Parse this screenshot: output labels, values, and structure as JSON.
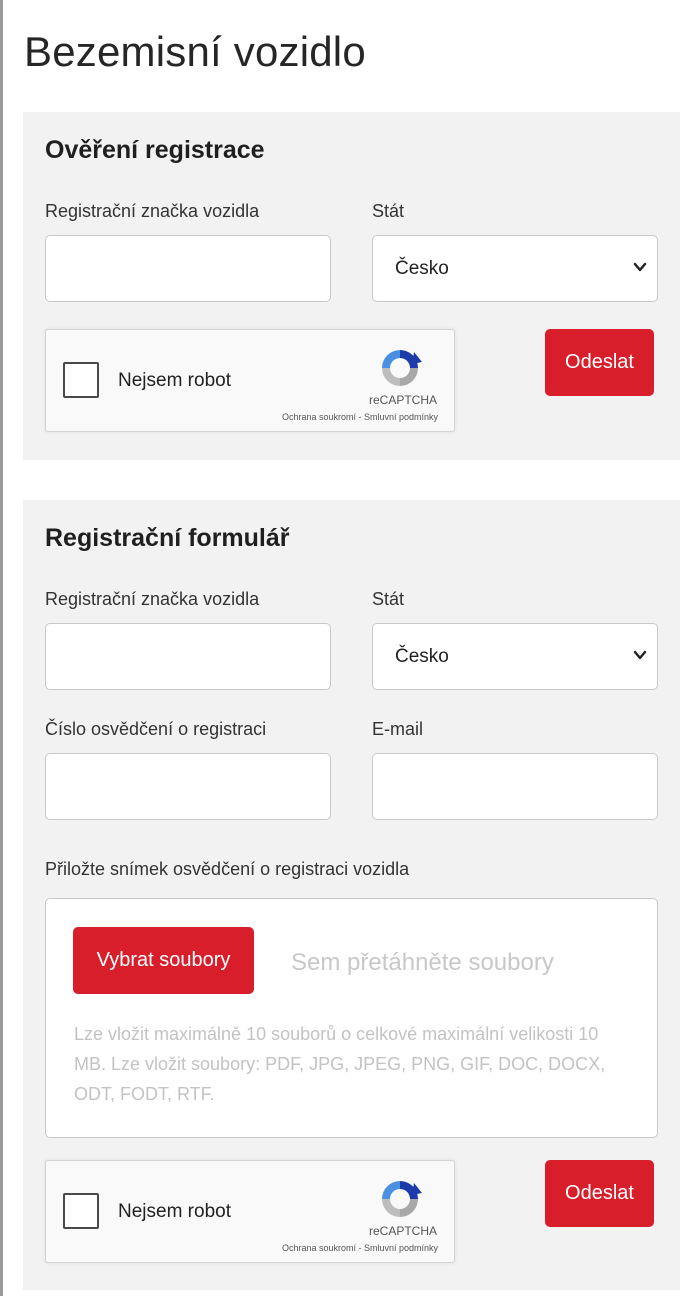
{
  "page": {
    "title": "Bezemisní vozidlo"
  },
  "verify": {
    "heading": "Ověření registrace",
    "plate_label": "Registrační značka vozidla",
    "plate_value": "",
    "state_label": "Stát",
    "state_value": "Česko",
    "captcha_label": "Nejsem robot",
    "captcha_brand": "reCAPTCHA",
    "captcha_links": "Ochrana soukromí - Smluvní podmínky",
    "submit_label": "Odeslat"
  },
  "register": {
    "heading": "Registrační formulář",
    "plate_label": "Registrační značka vozidla",
    "plate_value": "",
    "state_label": "Stát",
    "state_value": "Česko",
    "certificate_label": "Číslo osvědčení o registraci",
    "certificate_value": "",
    "email_label": "E-mail",
    "email_value": "",
    "attach_label": "Přiložte snímek osvědčení o registraci vozidla",
    "choose_files_label": "Vybrat soubory",
    "drop_hint": "Sem přetáhněte soubory",
    "upload_info": "Lze vložit maximálně 10 souborů o celkové maximální velikosti 10 MB. Lze vložit soubory: PDF, JPG, JPEG, PNG, GIF, DOC, DOCX, ODT, FODT, RTF.",
    "captcha_label": "Nejsem robot",
    "captcha_brand": "reCAPTCHA",
    "captcha_links": "Ochrana soukromí - Smluvní podmínky",
    "submit_label": "Odeslat"
  },
  "colors": {
    "accent": "#d91e2b",
    "panel": "#f2f2f2"
  }
}
